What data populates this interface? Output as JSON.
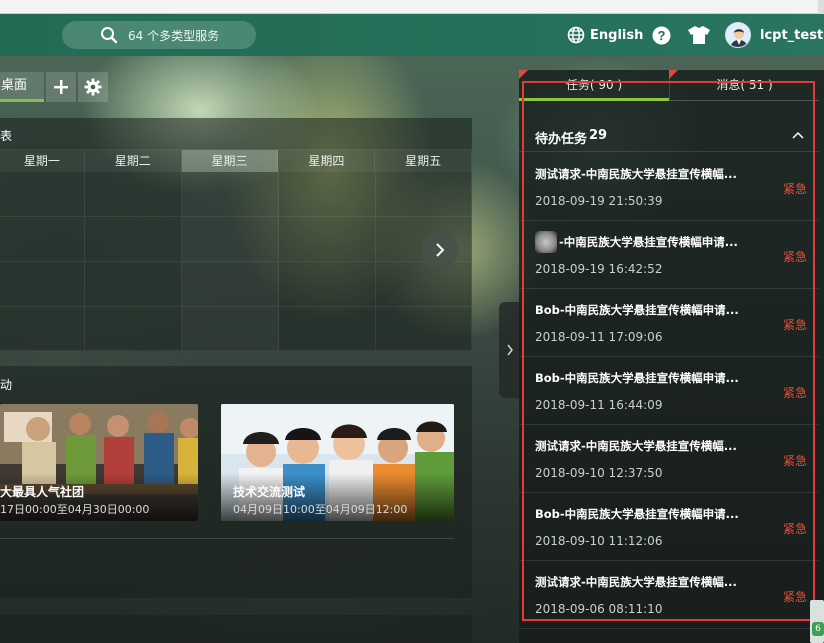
{
  "header": {
    "search_placeholder": "64 个多类型服务",
    "language": "English",
    "username": "lcpt_test"
  },
  "desktop": {
    "tab_label": "桌面"
  },
  "schedule": {
    "title": "表",
    "days": [
      "星期一",
      "星期二",
      "星期三",
      "星期四",
      "星期五"
    ],
    "today_index": 2
  },
  "activity": {
    "title": "动",
    "cards": [
      {
        "title": "大最具人气社团",
        "date": "17日00:00至04月30日00:00"
      },
      {
        "title": "技术交流测试",
        "date": "04月09日10:00至04月09日12:00"
      }
    ]
  },
  "right_panel": {
    "tabs": [
      {
        "label": "任务( 90 )",
        "active": true
      },
      {
        "label": "消息( 51 )",
        "active": false
      }
    ],
    "todo_label": "待办任务",
    "todo_count": "29",
    "tasks": [
      {
        "title": "测试请求-中南民族大学悬挂宣传横幅...",
        "date": "2018-09-19 21:50:39",
        "tag": "紧急",
        "blurred_avatar": false
      },
      {
        "title": "-中南民族大学悬挂宣传横幅申请...",
        "date": "2018-09-19 16:42:52",
        "tag": "紧急",
        "blurred_avatar": true
      },
      {
        "title": "Bob-中南民族大学悬挂宣传横幅申请...",
        "date": "2018-09-11 17:09:06",
        "tag": "紧急",
        "blurred_avatar": false
      },
      {
        "title": "Bob-中南民族大学悬挂宣传横幅申请...",
        "date": "2018-09-11 16:44:09",
        "tag": "紧急",
        "blurred_avatar": false
      },
      {
        "title": "测试请求-中南民族大学悬挂宣传横幅...",
        "date": "2018-09-10 12:37:50",
        "tag": "紧急",
        "blurred_avatar": false
      },
      {
        "title": "Bob-中南民族大学悬挂宣传横幅申请...",
        "date": "2018-09-10 11:12:06",
        "tag": "紧急",
        "blurred_avatar": false
      },
      {
        "title": "测试请求-中南民族大学悬挂宣传横幅...",
        "date": "2018-09-06 08:11:10",
        "tag": "紧急",
        "blurred_avatar": false
      }
    ]
  },
  "scroll_badge": "6",
  "colors": {
    "header": "#236c54",
    "accent_green": "#8cc63f",
    "urgent_red": "#e0523e",
    "highlight_box": "#e53a35"
  }
}
